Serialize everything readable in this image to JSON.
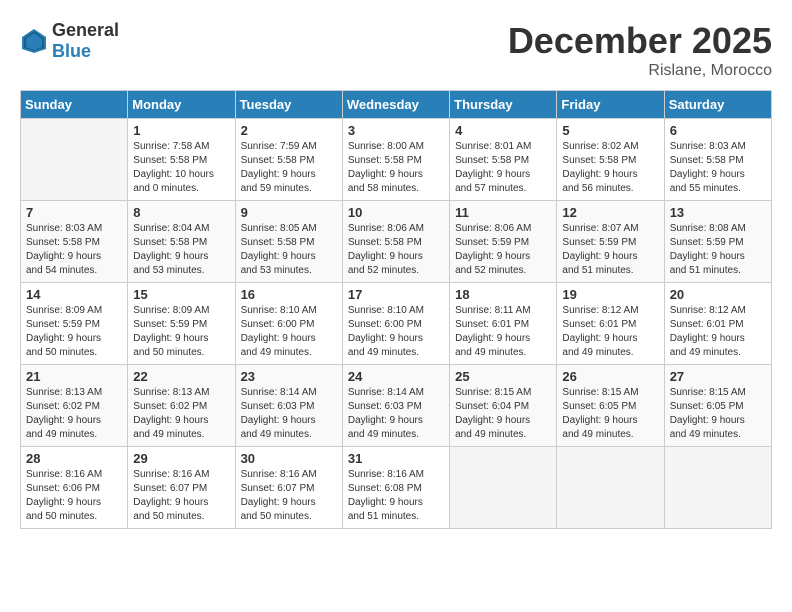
{
  "header": {
    "logo": {
      "general": "General",
      "blue": "Blue"
    },
    "month": "December 2025",
    "location": "Rislane, Morocco"
  },
  "weekdays": [
    "Sunday",
    "Monday",
    "Tuesday",
    "Wednesday",
    "Thursday",
    "Friday",
    "Saturday"
  ],
  "weeks": [
    [
      {
        "day": "",
        "info": ""
      },
      {
        "day": "1",
        "info": "Sunrise: 7:58 AM\nSunset: 5:58 PM\nDaylight: 10 hours\nand 0 minutes."
      },
      {
        "day": "2",
        "info": "Sunrise: 7:59 AM\nSunset: 5:58 PM\nDaylight: 9 hours\nand 59 minutes."
      },
      {
        "day": "3",
        "info": "Sunrise: 8:00 AM\nSunset: 5:58 PM\nDaylight: 9 hours\nand 58 minutes."
      },
      {
        "day": "4",
        "info": "Sunrise: 8:01 AM\nSunset: 5:58 PM\nDaylight: 9 hours\nand 57 minutes."
      },
      {
        "day": "5",
        "info": "Sunrise: 8:02 AM\nSunset: 5:58 PM\nDaylight: 9 hours\nand 56 minutes."
      },
      {
        "day": "6",
        "info": "Sunrise: 8:03 AM\nSunset: 5:58 PM\nDaylight: 9 hours\nand 55 minutes."
      }
    ],
    [
      {
        "day": "7",
        "info": "Sunrise: 8:03 AM\nSunset: 5:58 PM\nDaylight: 9 hours\nand 54 minutes."
      },
      {
        "day": "8",
        "info": "Sunrise: 8:04 AM\nSunset: 5:58 PM\nDaylight: 9 hours\nand 53 minutes."
      },
      {
        "day": "9",
        "info": "Sunrise: 8:05 AM\nSunset: 5:58 PM\nDaylight: 9 hours\nand 53 minutes."
      },
      {
        "day": "10",
        "info": "Sunrise: 8:06 AM\nSunset: 5:58 PM\nDaylight: 9 hours\nand 52 minutes."
      },
      {
        "day": "11",
        "info": "Sunrise: 8:06 AM\nSunset: 5:59 PM\nDaylight: 9 hours\nand 52 minutes."
      },
      {
        "day": "12",
        "info": "Sunrise: 8:07 AM\nSunset: 5:59 PM\nDaylight: 9 hours\nand 51 minutes."
      },
      {
        "day": "13",
        "info": "Sunrise: 8:08 AM\nSunset: 5:59 PM\nDaylight: 9 hours\nand 51 minutes."
      }
    ],
    [
      {
        "day": "14",
        "info": "Sunrise: 8:09 AM\nSunset: 5:59 PM\nDaylight: 9 hours\nand 50 minutes."
      },
      {
        "day": "15",
        "info": "Sunrise: 8:09 AM\nSunset: 5:59 PM\nDaylight: 9 hours\nand 50 minutes."
      },
      {
        "day": "16",
        "info": "Sunrise: 8:10 AM\nSunset: 6:00 PM\nDaylight: 9 hours\nand 49 minutes."
      },
      {
        "day": "17",
        "info": "Sunrise: 8:10 AM\nSunset: 6:00 PM\nDaylight: 9 hours\nand 49 minutes."
      },
      {
        "day": "18",
        "info": "Sunrise: 8:11 AM\nSunset: 6:01 PM\nDaylight: 9 hours\nand 49 minutes."
      },
      {
        "day": "19",
        "info": "Sunrise: 8:12 AM\nSunset: 6:01 PM\nDaylight: 9 hours\nand 49 minutes."
      },
      {
        "day": "20",
        "info": "Sunrise: 8:12 AM\nSunset: 6:01 PM\nDaylight: 9 hours\nand 49 minutes."
      }
    ],
    [
      {
        "day": "21",
        "info": "Sunrise: 8:13 AM\nSunset: 6:02 PM\nDaylight: 9 hours\nand 49 minutes."
      },
      {
        "day": "22",
        "info": "Sunrise: 8:13 AM\nSunset: 6:02 PM\nDaylight: 9 hours\nand 49 minutes."
      },
      {
        "day": "23",
        "info": "Sunrise: 8:14 AM\nSunset: 6:03 PM\nDaylight: 9 hours\nand 49 minutes."
      },
      {
        "day": "24",
        "info": "Sunrise: 8:14 AM\nSunset: 6:03 PM\nDaylight: 9 hours\nand 49 minutes."
      },
      {
        "day": "25",
        "info": "Sunrise: 8:15 AM\nSunset: 6:04 PM\nDaylight: 9 hours\nand 49 minutes."
      },
      {
        "day": "26",
        "info": "Sunrise: 8:15 AM\nSunset: 6:05 PM\nDaylight: 9 hours\nand 49 minutes."
      },
      {
        "day": "27",
        "info": "Sunrise: 8:15 AM\nSunset: 6:05 PM\nDaylight: 9 hours\nand 49 minutes."
      }
    ],
    [
      {
        "day": "28",
        "info": "Sunrise: 8:16 AM\nSunset: 6:06 PM\nDaylight: 9 hours\nand 50 minutes."
      },
      {
        "day": "29",
        "info": "Sunrise: 8:16 AM\nSunset: 6:07 PM\nDaylight: 9 hours\nand 50 minutes."
      },
      {
        "day": "30",
        "info": "Sunrise: 8:16 AM\nSunset: 6:07 PM\nDaylight: 9 hours\nand 50 minutes."
      },
      {
        "day": "31",
        "info": "Sunrise: 8:16 AM\nSunset: 6:08 PM\nDaylight: 9 hours\nand 51 minutes."
      },
      {
        "day": "",
        "info": ""
      },
      {
        "day": "",
        "info": ""
      },
      {
        "day": "",
        "info": ""
      }
    ]
  ]
}
